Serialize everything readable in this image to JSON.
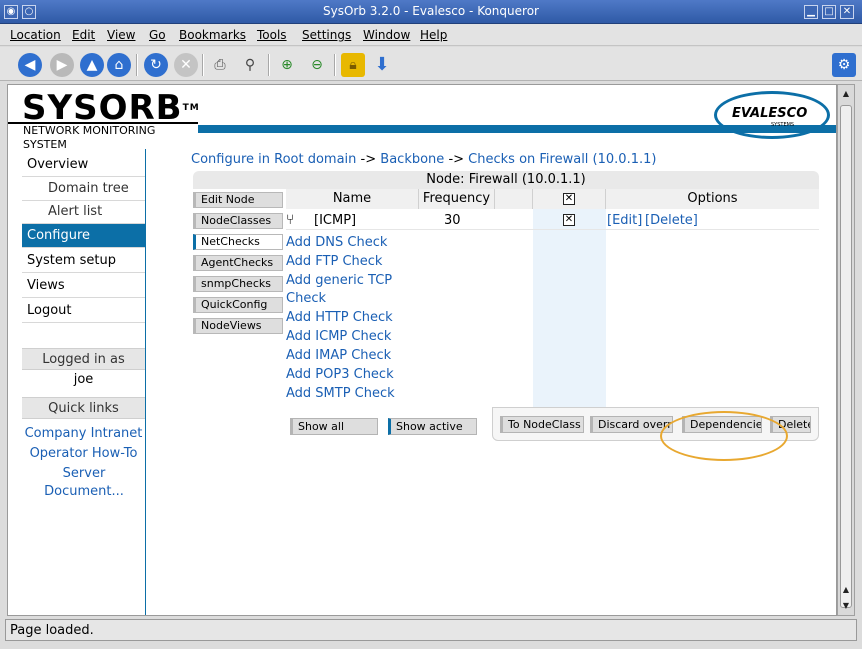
{
  "window": {
    "title": "SysOrb 3.2.0 - Evalesco - Konqueror"
  },
  "menu": [
    "Location",
    "Edit",
    "View",
    "Go",
    "Bookmarks",
    "Tools",
    "Settings",
    "Window",
    "Help"
  ],
  "toolbar_icons": [
    "back-icon",
    "forward-icon",
    "up-icon",
    "home-icon",
    "reload-icon",
    "stop-icon",
    "print-icon",
    "find-icon",
    "zoom-in-icon",
    "zoom-out-icon",
    "security-lock-icon",
    "download-icon"
  ],
  "header": {
    "logo": "SYSORB",
    "tm": "TM",
    "tagline": "NETWORK MONITORING SYSTEM",
    "brand": "EVALESCO",
    "brand_sub": "SYSTEMS"
  },
  "sidebar": {
    "items": [
      "Overview",
      "Domain tree",
      "Alert list",
      "Configure",
      "System setup",
      "Views",
      "Logout"
    ],
    "logged_in_label": "Logged in as",
    "user": "joe",
    "quick_links_label": "Quick links",
    "quick_links": [
      "Company Intranet",
      "Operator How-To",
      "Server Document..."
    ]
  },
  "breadcrumb": {
    "root": "Configure in Root domain",
    "sep1": "->",
    "mid": "Backbone",
    "sep2": "->",
    "leaf": "Checks on Firewall (10.0.1.1)"
  },
  "node_title": "Node: Firewall (10.0.1.1)",
  "tabs": [
    "Edit Node",
    "NodeClasses",
    "NetChecks",
    "AgentChecks",
    "snmpChecks",
    "QuickConfig",
    "NodeViews"
  ],
  "table": {
    "headers": [
      "Name",
      "Frequency",
      "",
      "",
      "Options"
    ],
    "row": {
      "name": "[ICMP]",
      "frequency": "30",
      "edit": "[Edit]",
      "delete": "[Delete]"
    },
    "add_links": [
      "Add DNS Check",
      "Add FTP Check",
      "Add generic TCP",
      "Check",
      "Add HTTP Check",
      "Add ICMP Check",
      "Add IMAP Check",
      "Add POP3 Check",
      "Add SMTP Check"
    ]
  },
  "buttons": {
    "show_all": "Show all",
    "show_active": "Show active",
    "to_nodeclass": "To NodeClass",
    "discard": "Discard override",
    "dependencies": "Dependencies",
    "delete": "Delete"
  },
  "status": "Page loaded.",
  "colors": {
    "accent": "#0c6fa7",
    "link": "#1a5fb4",
    "highlight_ring": "#e8a830"
  }
}
